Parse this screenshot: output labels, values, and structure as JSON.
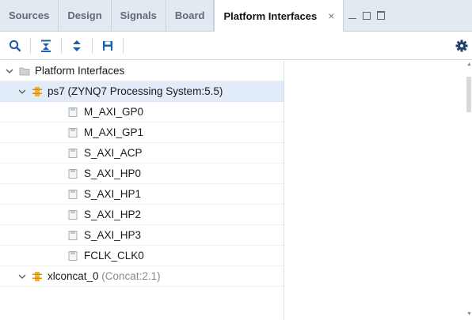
{
  "tabs": [
    {
      "label": "Sources"
    },
    {
      "label": "Design"
    },
    {
      "label": "Signals"
    },
    {
      "label": "Board"
    },
    {
      "label": "Platform Interfaces",
      "active": true,
      "close": "×"
    }
  ],
  "toolbar": {
    "icons": [
      "search-icon",
      "collapse-all-icon",
      "expand-all-icon",
      "save-icon"
    ],
    "settings_icon": "gear-icon"
  },
  "tree": {
    "root": {
      "label": "Platform Interfaces",
      "expanded": true
    },
    "ps7": {
      "label": "ps7 (ZYNQ7 Processing System:5.5)",
      "expanded": true,
      "selected": true
    },
    "interfaces": [
      "M_AXI_GP0",
      "M_AXI_GP1",
      "S_AXI_ACP",
      "S_AXI_HP0",
      "S_AXI_HP1",
      "S_AXI_HP2",
      "S_AXI_HP3",
      "FCLK_CLK0"
    ],
    "xlconcat": {
      "label": "xlconcat_0",
      "suffix": " (Concat:2.1)",
      "expanded": true
    }
  },
  "colors": {
    "tab_bar": "#e3e9f0",
    "selected_row": "#e2ecf9",
    "ip_icon": "#e8a51d",
    "accent_blue": "#1f5fa8"
  }
}
